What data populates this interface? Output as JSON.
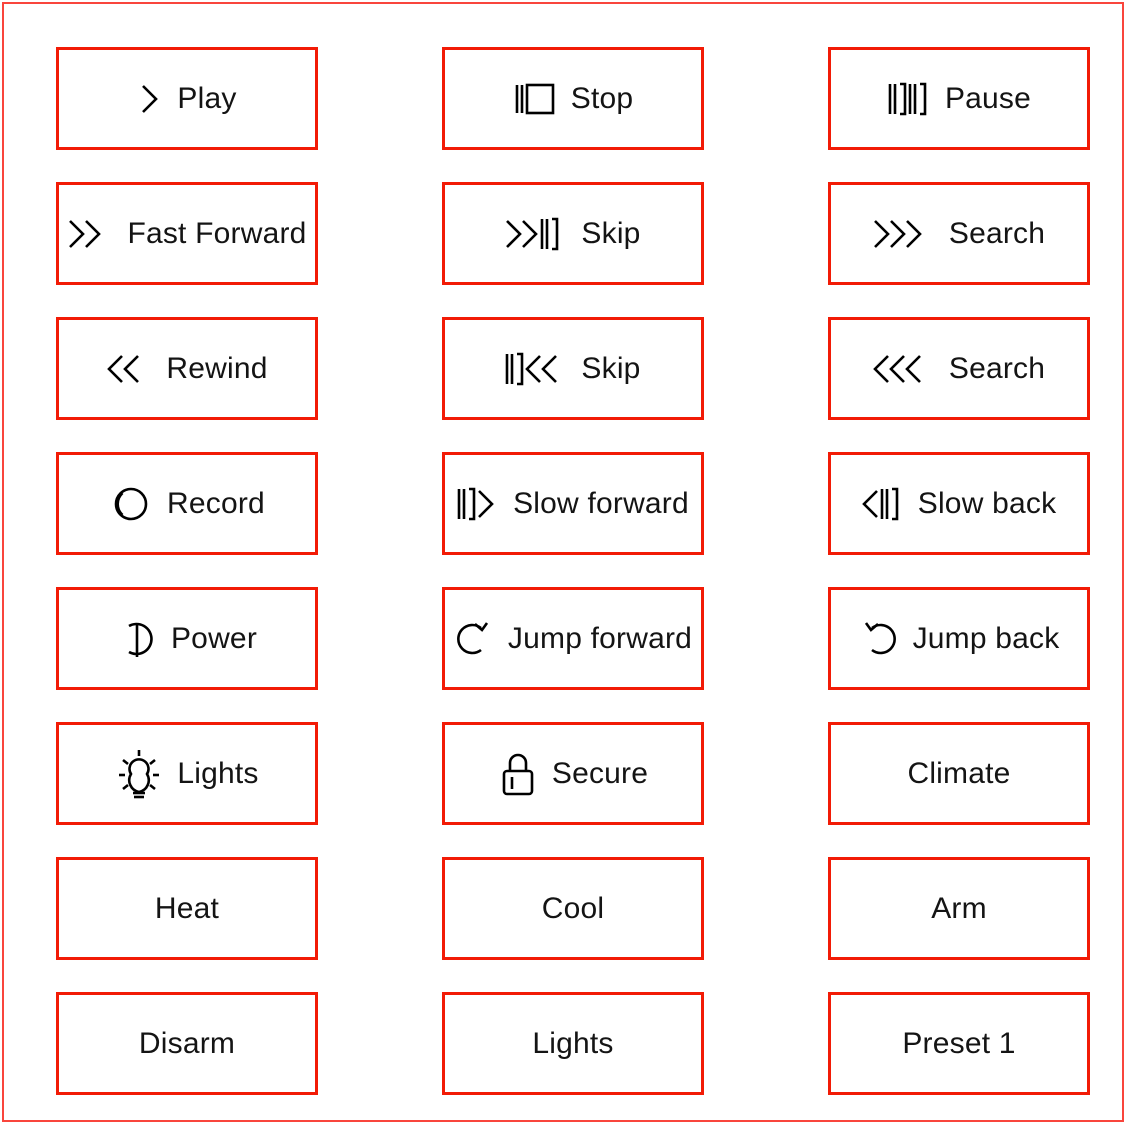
{
  "frame": {
    "border_color": "#f9453c",
    "background": "#ffffff"
  },
  "grid": {
    "columns": 3,
    "rows": 8,
    "button_border_color": "#f21b06",
    "label_color": "#141414"
  },
  "buttons": [
    {
      "id": "play",
      "label": "Play",
      "icon": "chevron-right-single-icon",
      "has_icon": true
    },
    {
      "id": "stop",
      "label": "Stop",
      "icon": "stop-bar-square-icon",
      "has_icon": true
    },
    {
      "id": "pause",
      "label": "Pause",
      "icon": "pause-double-bar-icon",
      "has_icon": true
    },
    {
      "id": "fast-forward",
      "label": "Fast Forward",
      "icon": "chevron-right-double-icon",
      "has_icon": true
    },
    {
      "id": "skip-forward",
      "label": "Skip",
      "icon": "chevron-right-double-bar-icon",
      "has_icon": true
    },
    {
      "id": "search-forward",
      "label": "Search",
      "icon": "chevron-right-triple-icon",
      "has_icon": true
    },
    {
      "id": "rewind",
      "label": "Rewind",
      "icon": "chevron-left-double-icon",
      "has_icon": true
    },
    {
      "id": "skip-back",
      "label": "Skip",
      "icon": "bar-chevron-left-double-icon",
      "has_icon": true
    },
    {
      "id": "search-back",
      "label": "Search",
      "icon": "chevron-left-triple-icon",
      "has_icon": true
    },
    {
      "id": "record",
      "label": "Record",
      "icon": "record-circle-icon",
      "has_icon": true
    },
    {
      "id": "slow-forward",
      "label": "Slow forward",
      "icon": "bar-chevron-right-icon",
      "has_icon": true
    },
    {
      "id": "slow-back",
      "label": "Slow back",
      "icon": "chevron-left-bar-icon",
      "has_icon": true
    },
    {
      "id": "power",
      "label": "Power",
      "icon": "power-icon",
      "has_icon": true
    },
    {
      "id": "jump-forward",
      "label": "Jump forward",
      "icon": "rotate-clockwise-icon",
      "has_icon": true
    },
    {
      "id": "jump-back",
      "label": "Jump back",
      "icon": "rotate-counterclockwise-icon",
      "has_icon": true
    },
    {
      "id": "lights",
      "label": "Lights",
      "icon": "lightbulb-icon",
      "has_icon": true
    },
    {
      "id": "secure",
      "label": "Secure",
      "icon": "lock-icon",
      "has_icon": true
    },
    {
      "id": "climate",
      "label": "Climate",
      "icon": "",
      "has_icon": false
    },
    {
      "id": "heat",
      "label": "Heat",
      "icon": "",
      "has_icon": false
    },
    {
      "id": "cool",
      "label": "Cool",
      "icon": "",
      "has_icon": false
    },
    {
      "id": "arm",
      "label": "Arm",
      "icon": "",
      "has_icon": false
    },
    {
      "id": "disarm",
      "label": "Disarm",
      "icon": "",
      "has_icon": false
    },
    {
      "id": "lights-2",
      "label": "Lights",
      "icon": "",
      "has_icon": false
    },
    {
      "id": "preset-1",
      "label": "Preset 1",
      "icon": "",
      "has_icon": false
    }
  ]
}
